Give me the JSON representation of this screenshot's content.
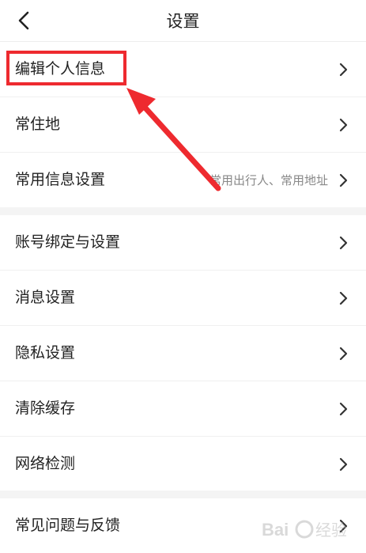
{
  "header": {
    "title": "设置",
    "back_icon": "chevron-left-icon"
  },
  "groups": [
    {
      "items": [
        {
          "label": "编辑个人信息",
          "value": ""
        },
        {
          "label": "常住地",
          "value": ""
        },
        {
          "label": "常用信息设置",
          "value": "常用出行人、常用地址"
        }
      ]
    },
    {
      "items": [
        {
          "label": "账号绑定与设置",
          "value": ""
        },
        {
          "label": "消息设置",
          "value": ""
        },
        {
          "label": "隐私设置",
          "value": ""
        },
        {
          "label": "清除缓存",
          "value": ""
        },
        {
          "label": "网络检测",
          "value": ""
        }
      ]
    },
    {
      "items": [
        {
          "label": "常见问题与反馈",
          "value": ""
        }
      ]
    }
  ],
  "annotation": {
    "highlight_color": "#ee2a2f"
  },
  "watermark": {
    "text": "Bai经验"
  },
  "colors": {
    "background": "#ffffff",
    "section_gap": "#f4f4f4",
    "text": "#222222",
    "secondary_text": "#888888",
    "chevron": "#333333"
  }
}
